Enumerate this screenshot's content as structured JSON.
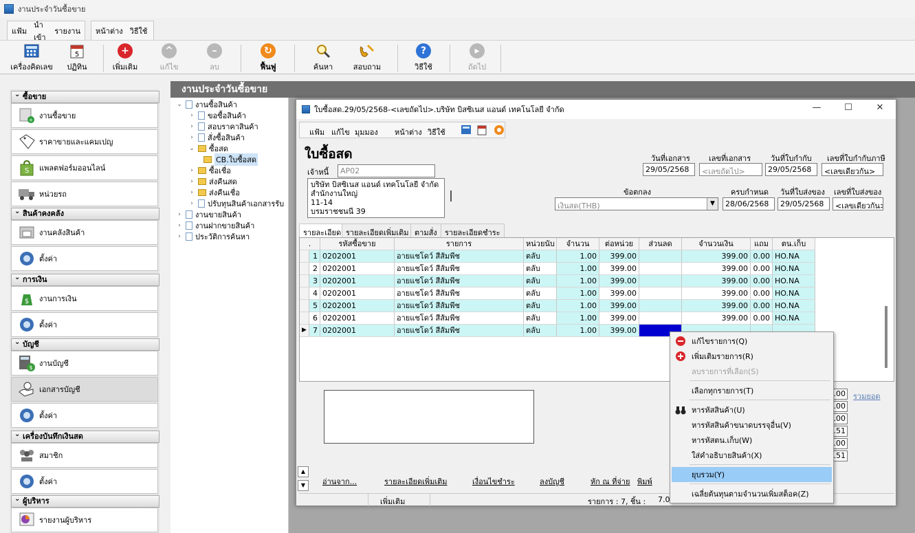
{
  "app": {
    "title": "งานประจำวันซื้อขาย"
  },
  "menu": {
    "file": "แฟ้ม",
    "import": "นำเข้า",
    "report": "รายงาน",
    "window": "หน้าต่าง",
    "howto": "วิธีใช้"
  },
  "toolbar": {
    "calculator": "เครื่องคิดเลข",
    "calendar": "ปฏิทิน",
    "add": "เพิ่มเติม",
    "edit": "แก้ไข",
    "delete": "ลบ",
    "restore": "ฟื้นฟู",
    "search": "ค้นหา",
    "inquiry": "สอบถาม",
    "help": "วิธีใช้",
    "next": "ถัดไป"
  },
  "leftnav": {
    "sections": [
      {
        "title": "ซื้อขาย",
        "items": [
          "งานซื้อขาย",
          "ราคาขายและแคมเปญ",
          "แพลตฟอร์มออนไลน์",
          "หน่วยรถ"
        ]
      },
      {
        "title": "สินค้าคงคลัง",
        "items": [
          "งานคลังสินค้า",
          "ตั้งค่า"
        ]
      },
      {
        "title": "การเงิน",
        "items": [
          "งานการเงิน",
          "ตั้งค่า"
        ]
      },
      {
        "title": "บัญชี",
        "items": [
          "งานบัญชี",
          "เอกสารบัญชี",
          "ตั้งค่า"
        ]
      },
      {
        "title": "เครื่องบันทึกเงินสด",
        "items": [
          "สมาชิก",
          "ตั้งค่า"
        ]
      },
      {
        "title": "ผู้บริหาร",
        "items": [
          "รายงานผู้บริหาร"
        ]
      }
    ]
  },
  "content": {
    "header": "งานประจำวันซื้อขาย"
  },
  "tree": {
    "n0": "งานซื้อสินค้า",
    "n1": "ขอซื้อสินค้า",
    "n2": "สอบราคาสินค้า",
    "n3": "สั่งซื้อสินค้า",
    "n4": "ซื้อสด",
    "n5": "CB.ใบซื้อสด",
    "n6": "ซื้อเชื่อ",
    "n7": "ส่งคืนสด",
    "n8": "ส่งคืนเชื่อ",
    "n9": "ปรับทุนสินค้าเอกสารรับ",
    "n10": "งานขายสินค้า",
    "n11": "งานฝากขายสินค้า",
    "n12": "ประวัติการค้นหา"
  },
  "window": {
    "title": "ใบซื้อสด.29/05/2568-<เลขถัดไป>.บริษัท บิสซิเนส แอนด์ เทคโนโลยี จำกัด",
    "menu": {
      "file": "แฟ้ม",
      "edit": "แก้ไข",
      "view": "มุมมอง",
      "window": "หน้าต่าง",
      "howto": "วิธีใช้"
    },
    "doc_title": "ใบซื้อสด",
    "creditor_label": "เจ้าหนี้",
    "creditor_code": "AP02",
    "address": [
      "บริษัท บิสซิเนส แอนด์ เทคโนโลยี จำกัด",
      "สำนักงานใหญ่",
      "11-14",
      "บรมราชชนนี 39"
    ],
    "doc_date_label": "วันที่เอกสาร",
    "doc_date": "29/05/2568",
    "doc_no_label": "เลขที่เอกสาร",
    "doc_no": "<เลขถัดไป>",
    "tax_date_label": "วันที่ใบกำกับ",
    "tax_date": "29/05/2568",
    "tax_no_label": "เลขที่ใบกำกับภาษี",
    "tax_no": "<เลขเดียวกัน>",
    "terms_label": "ข้อตกลง",
    "terms": "เงินสด(THB)",
    "due_label": "ครบกำหนด",
    "due": "28/06/2568",
    "deliv_date_label": "วันที่ใบส่งของ",
    "deliv_date": "29/05/2568",
    "deliv_no_label": "เลขที่ใบส่งของ",
    "deliv_no": "<เลขเดียวกัน>",
    "tabs": [
      "รายละเอียด",
      "รายละเอียดเพิ่มเติม",
      "ตามสั่ง",
      "รายละเอียดชำระ"
    ],
    "grid": {
      "headers": [
        ".",
        "รหัสซื้อขาย",
        "รายการ",
        "หน่วยนับ",
        "จำนวน",
        "ต่อหน่วย",
        "ส่วนลด",
        "จำนวนเงิน",
        "แถม",
        "ตน.เก็บ"
      ],
      "rows": [
        [
          "1",
          "0202001",
          "อายแชโดว์ สีส้มพีช",
          "ตลับ",
          "1.00",
          "399.00",
          "",
          "399.00",
          "0.00",
          "HO.NA"
        ],
        [
          "2",
          "0202001",
          "อายแชโดว์ สีส้มพีช",
          "ตลับ",
          "1.00",
          "399.00",
          "",
          "399.00",
          "0.00",
          "HO.NA"
        ],
        [
          "3",
          "0202001",
          "อายแชโดว์ สีส้มพีช",
          "ตลับ",
          "1.00",
          "399.00",
          "",
          "399.00",
          "0.00",
          "HO.NA"
        ],
        [
          "4",
          "0202001",
          "อายแชโดว์ สีส้มพีช",
          "ตลับ",
          "1.00",
          "399.00",
          "",
          "399.00",
          "0.00",
          "HO.NA"
        ],
        [
          "5",
          "0202001",
          "อายแชโดว์ สีส้มพีช",
          "ตลับ",
          "1.00",
          "399.00",
          "",
          "399.00",
          "0.00",
          "HO.NA"
        ],
        [
          "6",
          "0202001",
          "อายแชโดว์ สีส้มพีช",
          "ตลับ",
          "1.00",
          "399.00",
          "",
          "399.00",
          "0.00",
          "HO.NA"
        ],
        [
          "7",
          "0202001",
          "อายแชโดว์ สีส้มพีช",
          "ตลับ",
          "1.00",
          "399.00",
          "",
          "",
          "",
          ""
        ]
      ]
    },
    "links": [
      "อ่านจาก...",
      "รายละเอียดเพิ่มเติม",
      "เงื่อนไขชำระ",
      "ลงบัญชี",
      "หัก ณ ที่จ่าย",
      "พิมพ์"
    ],
    "sum_label": "รวมยอด",
    "sum_values": [
      ".00",
      ".00",
      ".00",
      ".51",
      ".00",
      ".51"
    ],
    "status": {
      "mode": "เพิ่มเติม",
      "count": "รายการ : 7, ชิ้น :",
      "qty": "7.00"
    }
  },
  "context_menu": {
    "edit_item": "แก้ไขรายการ(Q)",
    "add_item": "เพิ่มเติมรายการ(R)",
    "delete_selected": "ลบรายการที่เลือก(S)",
    "select_all": "เลือกทุกรายการ(T)",
    "find_product": "หารหัสสินค้า(U)",
    "find_product_other": "หารหัสสินค้าขนาดบรรจุอื่น(V)",
    "find_location": "หารหัสตน.เก็บ(W)",
    "product_desc": "ใส่คำอธิบายสินค้า(X)",
    "collapse": "ยุบรวม(Y)",
    "avg_cost": "เฉลี่ยต้นทุนตามจำนวนเพิ่มสต็อค(Z)"
  },
  "colors": {
    "row_cyan": "#ccf5f5",
    "selected_cell": "#0000d0",
    "menu_highlight": "#99ccf7",
    "header_bar": "#707070"
  }
}
